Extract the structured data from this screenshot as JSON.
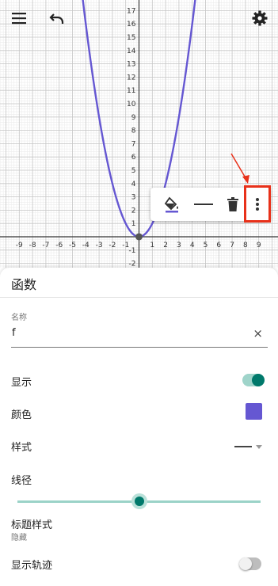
{
  "graph": {
    "x_ticks": [
      "-9",
      "-8",
      "-7",
      "-6",
      "-5",
      "-4",
      "-3",
      "-2",
      "-1",
      "1",
      "2",
      "3",
      "4",
      "5",
      "6",
      "7",
      "8",
      "9"
    ],
    "y_ticks": [
      "1",
      "2",
      "3",
      "4",
      "5",
      "6",
      "7",
      "8",
      "9",
      "10",
      "11",
      "12",
      "13",
      "14",
      "15",
      "16",
      "17"
    ],
    "y_neg_ticks": [
      "-1",
      "-2"
    ],
    "curve_color": "#6557d2"
  },
  "topbar": {
    "menu_icon": "hamburger-menu-icon",
    "undo_icon": "undo-icon",
    "settings_icon": "gear-icon"
  },
  "toolbar": {
    "icons": [
      "paint-bucket-icon",
      "line-style-icon",
      "trash-icon",
      "more-vert-icon"
    ]
  },
  "panel": {
    "title": "函数",
    "name_label": "名称",
    "name_value": "f",
    "clear_icon": "×",
    "show_label": "显示",
    "show_on": true,
    "color_label": "颜色",
    "color_value": "#6557d2",
    "style_label": "样式",
    "thickness_label": "线径",
    "thickness_fraction": 0.5,
    "caption_label": "标题样式",
    "caption_value": "隐藏",
    "trace_label": "显示轨迹",
    "trace_on": false,
    "accent_color": "#00897b"
  }
}
